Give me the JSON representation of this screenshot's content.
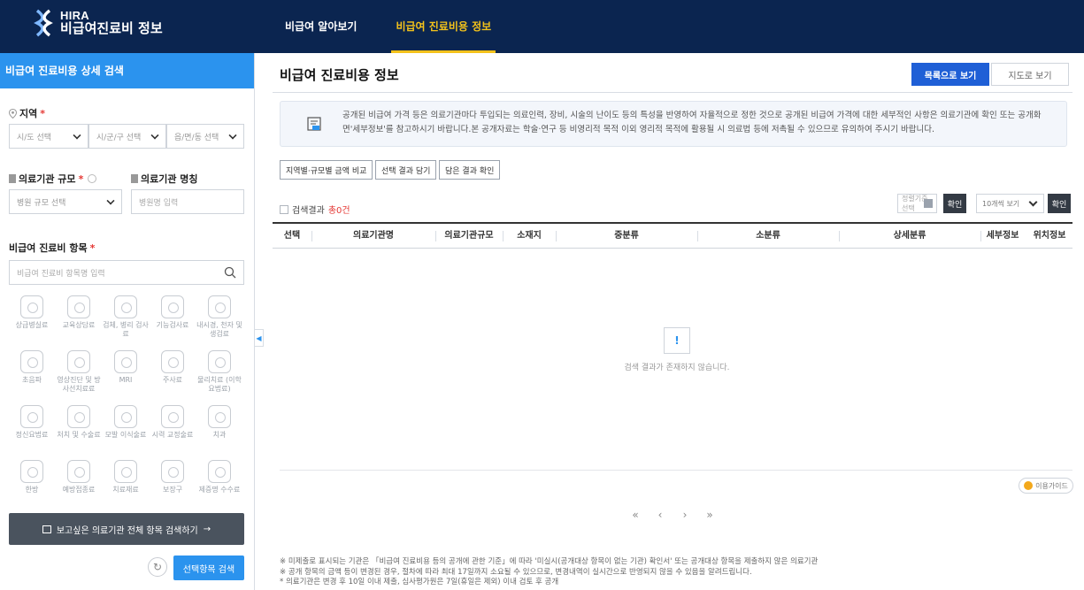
{
  "header": {
    "logo_en": "HIRA",
    "logo_ko": "비급여진료비 정보",
    "nav": [
      "비급여 알아보기",
      "비급여 진료비용 정보"
    ],
    "active_nav": "비급여 진료비용 정보",
    "colors": {
      "navy": "#0b2550",
      "accent": "#f3c21b"
    }
  },
  "left": {
    "title": "비급여 진료비용 상세 검색",
    "region_label": "지역",
    "region_selects": [
      "시/도 선택",
      "시/군/구 선택",
      "읍/면/동 선택"
    ],
    "scale_label": "의료기관 규모",
    "scale_select": "병원 규모 선택",
    "name_label": "의료기관 명칭",
    "name_placeholder": "병원명 입력",
    "item_label": "비급여 진료비 항목",
    "item_placeholder": "비급여 진료비 항목명 입력",
    "categories": [
      "상급병실료",
      "교육상담료",
      "검체, 병리 검사료",
      "기능검사료",
      "내시경, 천자 및 생검료",
      "초음파",
      "영상진단 및 방사선치료료",
      "MRI",
      "주사료",
      "물리치료 (이학요법료)",
      "정신요법료",
      "처치 및 수술료",
      "모발 이식술료",
      "시력 교정술료",
      "치과",
      "한방",
      "예방접종료",
      "치료재료",
      "보장구",
      "제증명 수수료"
    ],
    "all_items_button": "보고싶은 의료기관 전체 항목 검색하기",
    "search_button": "선택항목 검색",
    "colors": {
      "blue": "#2b93ee"
    }
  },
  "main": {
    "title": "비급여 진료비용 정보",
    "view_list": "목록으로 보기",
    "view_map": "지도로 보기",
    "notice": "공개된 비급여 가격 등은 의료기관마다 투입되는 의료인력, 장비, 시술의 난이도 등의 특성을 반영하여 자율적으로 정한 것으로 공개된 비급여 가격에 대한 세부적인 사항은 의료기관에 확인 또는 공개화면'세부정보'를 참고하시기 바랍니다.본 공개자료는 학술·연구 등 비영리적 목적 이외 영리적 목적에 활용될 시 의료법 등에 저촉될 수 있으므로 유의하여 주시기 바랍니다.",
    "tools": [
      "지역별·규모별 금액 비교",
      "선택 결과 담기",
      "담은 결과 확인"
    ],
    "result_prefix": "검색결과",
    "result_count": "총0건",
    "sort_select": "정렬기준 선택",
    "confirm": "확인",
    "per_page": "10개씩 보기",
    "columns": [
      "선택",
      "의료기관명",
      "의료기관규모",
      "소재지",
      "중분류",
      "소분류",
      "상세분류",
      "세부정보",
      "위치정보"
    ],
    "empty_icon": "!",
    "empty_text": "검색 결과가 존재하지 않습니다.",
    "guide": "이용가이드",
    "pager": [
      "«",
      "‹",
      "›",
      "»"
    ],
    "footnotes": [
      "※ 미제출로 표시되는 기관은 「비급여 진료비용 등의 공개에 관한 기준」에 따라 '미실시(공개대상 항목이 없는 기관) 확인서' 또는 공개대상 항목을 제출하지 않은 의료기관",
      "※ 공개 항목의 금액 등이 변경된 경우, 절차에 따라 최대 17일까지 소요될 수 있으므로, 변경내역이 실시간으로 반영되지 않을 수 있음을 알려드립니다.",
      "* 의료기관은 변경 후 10일 이내 제출, 심사평가원은 7일(휴일은 제외) 이내 검토 후 공개"
    ],
    "colors": {
      "primary": "#1f5fd6",
      "count_red": "#e53935"
    }
  }
}
